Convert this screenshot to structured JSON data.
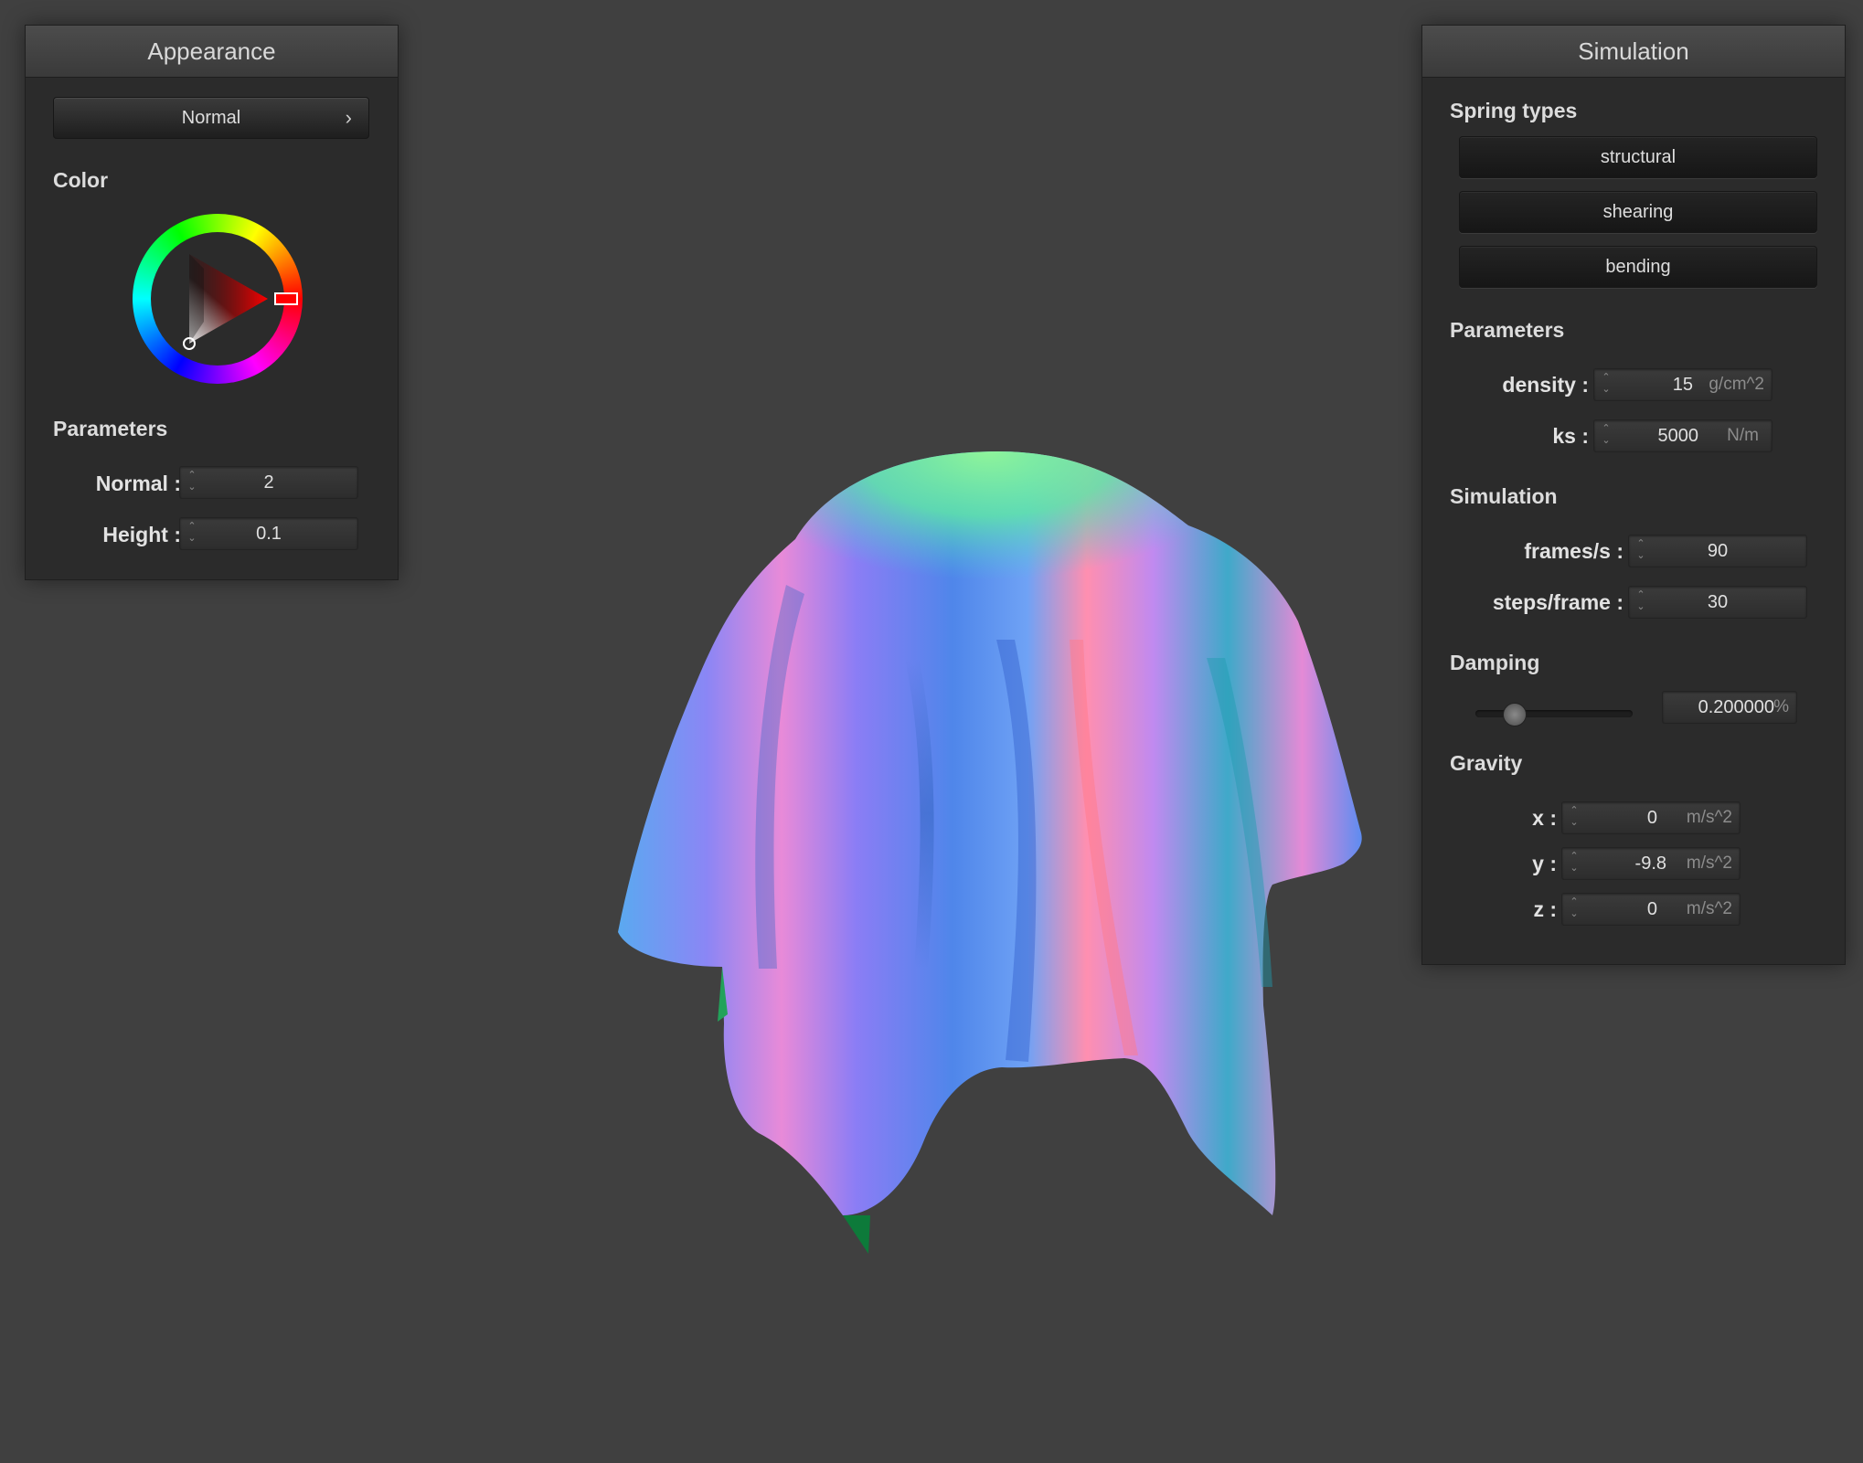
{
  "appearance": {
    "title": "Appearance",
    "shader_label": "Normal",
    "shader_chevron": "›",
    "color_label": "Color",
    "parameters_label": "Parameters",
    "normal": {
      "label": "Normal :",
      "value": "2"
    },
    "height": {
      "label": "Height :",
      "value": "0.1"
    },
    "selected_color": "#ff0000"
  },
  "simulation": {
    "title": "Simulation",
    "spring_types_label": "Spring types",
    "spring_buttons": [
      "structural",
      "shearing",
      "bending"
    ],
    "parameters_label": "Parameters",
    "density": {
      "label": "density :",
      "value": "15",
      "unit": "g/cm^2"
    },
    "ks": {
      "label": "ks :",
      "value": "5000",
      "unit": "N/m"
    },
    "simulation_label": "Simulation",
    "fps": {
      "label": "frames/s :",
      "value": "90"
    },
    "steps": {
      "label": "steps/frame :",
      "value": "30"
    },
    "damping_label": "Damping",
    "damping": {
      "value": "0.200000",
      "unit": "%",
      "slider_fraction": 0.2
    },
    "gravity_label": "Gravity",
    "gravity": {
      "x": {
        "label": "x :",
        "value": "0",
        "unit": "m/s^2"
      },
      "y": {
        "label": "y :",
        "value": "-9.8",
        "unit": "m/s^2"
      },
      "z": {
        "label": "z :",
        "value": "0",
        "unit": "m/s^2"
      }
    }
  },
  "colors": {
    "background": "#404040",
    "panel": "#2b2b2b"
  }
}
